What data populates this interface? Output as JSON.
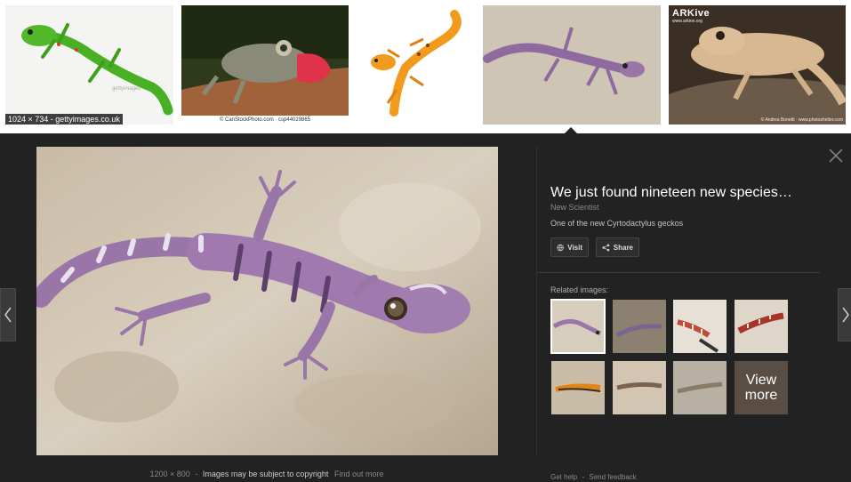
{
  "results_strip": {
    "thumbnails": [
      {
        "caption": "1024 × 734 - gettyimages.co.uk",
        "alt": "green gecko"
      },
      {
        "watermark": "© CanStockPhoto.com · csp44029865",
        "alt": "leaf-tailed gecko with open mouth"
      },
      {
        "alt": "orange gecko illustration"
      },
      {
        "alt": "purple bent-toed gecko"
      },
      {
        "brand": "ARKive",
        "brand_sub": "www.arkive.org",
        "credit": "© Andrea Bonetti · www.photoshelter.com",
        "alt": "pale tan gecko on rock"
      }
    ]
  },
  "preview": {
    "title": "We just found nineteen new species…",
    "source": "New Scientist",
    "description": "One of the new Cyrtodactylus geckos",
    "buttons": {
      "visit": "Visit",
      "share": "Share"
    },
    "image_meta": {
      "dimensions": "1200 × 800",
      "separator": "-",
      "copyright": "Images may be subject to copyright",
      "find_out_more": "Find out more"
    },
    "related_label": "Related images:",
    "view_more": "View more",
    "footer": {
      "help": "Get help",
      "separator": "-",
      "feedback": "Send feedback"
    }
  },
  "icons": {
    "close": "close-icon",
    "prev": "chevron-left-icon",
    "next": "chevron-right-icon",
    "visit": "globe-icon",
    "share": "share-icon"
  },
  "colors": {
    "panel_bg": "#222222",
    "gecko_purple": "#9a76a8",
    "gecko_green": "#4caf26",
    "gecko_orange": "#f59a1c"
  }
}
